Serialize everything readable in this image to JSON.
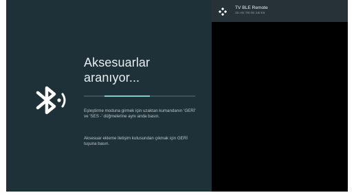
{
  "pairing": {
    "title": "Aksesuarlar aranıyor...",
    "progress": 0.6,
    "instruction": "Eşleştirme moduna girmek için uzaktan kumandanın 'GERİ' ve 'SES -' düğmelerine aynı anda basın.",
    "exit_hint": "Aksesuar ekleme iletişim kutusundan çıkmak için GERİ tuşuna basın."
  },
  "devices": [
    {
      "name": "TV BLE Remote",
      "address": "30:AE:7B:0E:1B:E5",
      "icon": "gamepad-icon"
    }
  ],
  "colors": {
    "left_background": "#1f3138",
    "accent": "#7fcfc4",
    "selected_row": "#263238",
    "right_background": "#000000"
  },
  "icons": {
    "main": "bluetooth-searching-icon"
  }
}
